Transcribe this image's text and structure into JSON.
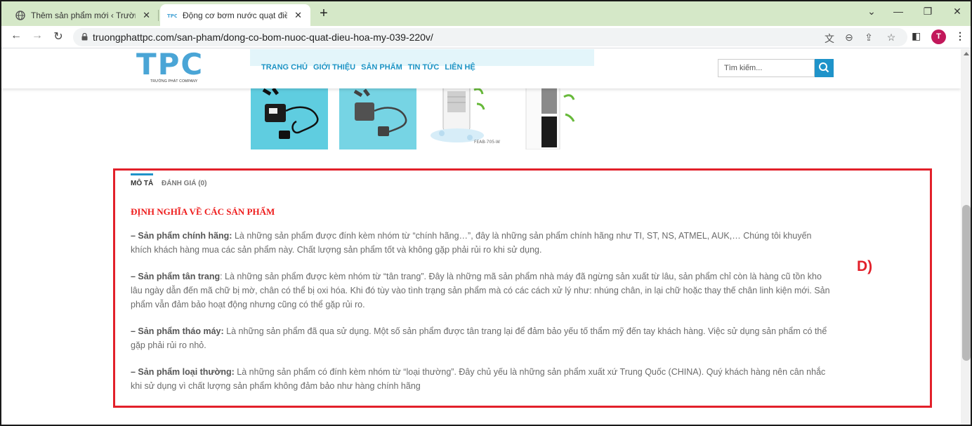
{
  "browser": {
    "tabs": [
      {
        "title": "Thêm sản phẩm mới ‹ Trường Phát",
        "active": false,
        "icon": "globe-icon"
      },
      {
        "title": "Động cơ bơm nước quạt điều hòa",
        "active": true,
        "icon": "site-favicon"
      }
    ],
    "new_tab_label": "+",
    "url": "truongphattpc.com/san-pham/dong-co-bom-nuoc-quat-dieu-hoa-my-039-220v/",
    "profile_initial": "T",
    "profile_color": "#c2185b"
  },
  "site": {
    "logo_text": "TPC",
    "logo_subtext": "TRƯỜNG PHÁT COMPANY",
    "nav": [
      "TRANG CHỦ",
      "GIỚI THIỆU",
      "SẢN PHẨM",
      "TIN TỨC",
      "LIÊN HỆ"
    ],
    "search_placeholder": "Tìm kiếm...",
    "accent_color": "#1f93c9"
  },
  "product": {
    "thumbnails": [
      {
        "icon": "water-pump-image"
      },
      {
        "icon": "water-pump-image"
      },
      {
        "icon": "air-cooler-image",
        "caption": "FEAB-705-W"
      },
      {
        "icon": "air-cooler-image"
      }
    ],
    "tabs": [
      "MÔ TẢ",
      "ĐÁNH GIÁ (0)"
    ],
    "active_tab": "MÔ TẢ",
    "description": {
      "heading": "ĐỊNH NGHĨA VỀ CÁC SẢN PHẨM",
      "paragraphs": [
        {
          "term": "– Sản phẩm chính hãng:",
          "text": " Là những sản phẩm được đính kèm nhóm từ “chính hãng…”, đây là những sản phẩm chính hãng như TI, ST, NS, ATMEL, AUK,… Chúng tôi khuyến khích khách hàng mua các sản phẩm này.  Chất lượng sản phẩm tốt và không gặp phải rủi ro khi sử dụng."
        },
        {
          "term": "– Sản phẩm tân trang",
          "text": ": Là những sản phẩm được kèm nhóm từ “tân trang”. Đây là những mã sản phẩm nhà máy đã ngừng sản xuất từ lâu, sản phẩm chỉ còn là hàng cũ tồn kho lâu ngày dẫn đến mã chữ bị mờ, chân có thể bị oxi hóa. Khi đó tùy vào tình trạng sản phẩm mà có các cách xử lý như: nhúng chân, in lại chữ hoặc thay thế chân linh kiện mới. Sản phẩm vẫn đảm bảo hoạt động nhưng cũng có thể gặp rủi ro."
        },
        {
          "term": "– Sản phẩm tháo máy:",
          "text": " Là những sản phẩm đã qua sử dụng. Một số sản phẩm được tân trang lại để đảm bảo yếu tố thẩm mỹ đến tay khách hàng. Việc sử dụng sản phẩm có thể gặp phải rủi ro nhỏ."
        },
        {
          "term": "– Sản phẩm loại thường:",
          "text": " Là những sản phẩm có đính kèm nhóm từ “loại thường”. Đây chủ yếu là những sản phẩm xuất xứ Trung Quốc (CHINA). Quý khách hàng nên cân nhắc khi sử dụng vì chất lượng sản phẩm không đảm bảo như hàng chính hãng"
        }
      ]
    }
  },
  "annotation": {
    "label": "D)",
    "color": "#e2202a"
  }
}
